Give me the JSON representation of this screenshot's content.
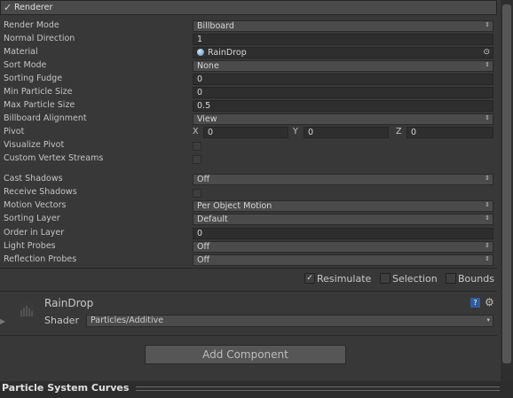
{
  "header": {
    "checkbox": "✓",
    "title": "Renderer"
  },
  "rows": [
    {
      "label": "Render Mode",
      "value": "Billboard",
      "kind": "dropdown"
    },
    {
      "label": "Normal Direction",
      "value": "1",
      "kind": "number"
    },
    {
      "label": "Material",
      "value": "RainDrop",
      "kind": "object"
    },
    {
      "label": "Sort Mode",
      "value": "None",
      "kind": "dropdown"
    },
    {
      "label": "Sorting Fudge",
      "value": "0",
      "kind": "number"
    },
    {
      "label": "Min Particle Size",
      "value": "0",
      "kind": "number"
    },
    {
      "label": "Max Particle Size",
      "value": "0.5",
      "kind": "number"
    },
    {
      "label": "Billboard Alignment",
      "value": "View",
      "kind": "dropdown"
    },
    {
      "label": "Pivot",
      "kind": "vector",
      "x_label": "X",
      "x": "0",
      "y_label": "Y",
      "y": "0",
      "z_label": "Z",
      "z": "0"
    },
    {
      "label": "Visualize Pivot",
      "kind": "checkbox"
    },
    {
      "label": "Custom Vertex Streams",
      "kind": "checkbox"
    },
    {
      "label": "Cast Shadows",
      "value": "Off",
      "kind": "dropdown"
    },
    {
      "label": "Receive Shadows",
      "kind": "checkbox"
    },
    {
      "label": "Motion Vectors",
      "value": "Per Object Motion",
      "kind": "dropdown"
    },
    {
      "label": "Sorting Layer",
      "value": "Default",
      "kind": "dropdown"
    },
    {
      "label": "Order in Layer",
      "value": "0",
      "kind": "number"
    },
    {
      "label": "Light Probes",
      "value": "Off",
      "kind": "dropdown"
    },
    {
      "label": "Reflection Probes",
      "value": "Off",
      "kind": "dropdown"
    }
  ],
  "toggles": [
    {
      "label": "Resimulate",
      "checked": true
    },
    {
      "label": "Selection",
      "checked": false
    },
    {
      "label": "Bounds",
      "checked": false
    }
  ],
  "material": {
    "name": "RainDrop",
    "shader_label": "Shader",
    "shader": "Particles/Additive"
  },
  "add_component": "Add Component",
  "footer": {
    "title": "Particle System Curves"
  },
  "icons": {
    "dropdown": "⇕",
    "object_picker": "⊙",
    "help": "?",
    "gear": "⚙"
  }
}
